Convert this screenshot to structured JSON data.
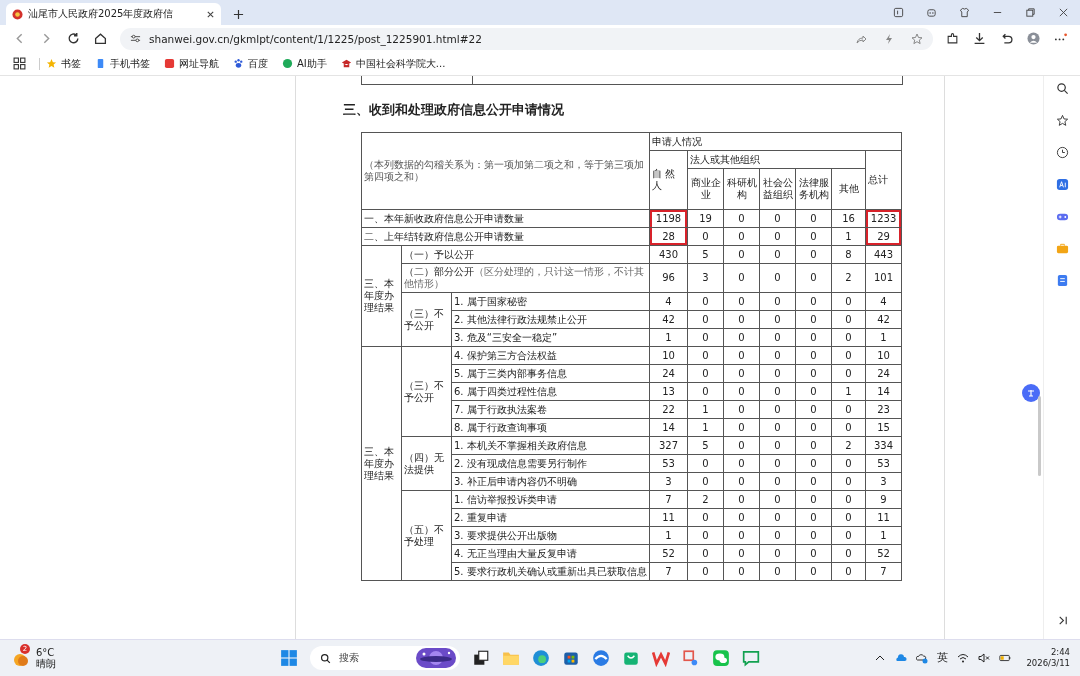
{
  "browser": {
    "tab_title": "汕尾市人民政府2025年度政府信",
    "url": "shanwei.gov.cn/gkmlpt/content/1/1225/post_1225901.html#22",
    "bookmarks": [
      {
        "label": "书签",
        "kind": "star"
      },
      {
        "label": "手机书签",
        "kind": "phone"
      },
      {
        "label": "网址导航",
        "kind": "nav"
      },
      {
        "label": "百度",
        "kind": "paw"
      },
      {
        "label": "AI助手",
        "kind": "ai"
      },
      {
        "label": "中国社会科学院大...",
        "kind": "school"
      }
    ]
  },
  "document": {
    "heading": "三、收到和处理政府信息公开申请情况",
    "table": {
      "note": "（本列数据的勾稽关系为：第一项加第二项之和，等于第三项加第四项之和）",
      "applicant_header": "申请人情况",
      "org_header": "法人或其他组织",
      "columns": [
        {
          "label": "自 然人",
          "boxed": true
        },
        {
          "label": "商业企业",
          "boxed": false
        },
        {
          "label": "科研机构",
          "boxed": false
        },
        {
          "label": "社会公益组织",
          "boxed": false
        },
        {
          "label": "法律服务机构",
          "boxed": false
        },
        {
          "label": "其他",
          "boxed": false
        },
        {
          "label": "总计",
          "boxed": true
        }
      ],
      "summary_rows": [
        {
          "label": "一、本年新收政府信息公开申请数量",
          "values": [
            "1198",
            "19",
            "0",
            "0",
            "0",
            "16",
            "1233"
          ]
        },
        {
          "label": "二、上年结转政府信息公开申请数量",
          "values": [
            "28",
            "0",
            "0",
            "0",
            "0",
            "1",
            "29"
          ]
        }
      ],
      "sections": [
        {
          "label": "三、本年度办理结果",
          "groups": [
            {
              "label": "（一）予以公开",
              "values": [
                "430",
                "5",
                "0",
                "0",
                "0",
                "8",
                "443"
              ]
            },
            {
              "label": "（二）部分公开",
              "note": "（区分处理的，只计这一情形，不计其他情形）",
              "values": [
                "96",
                "3",
                "0",
                "0",
                "0",
                "2",
                "101"
              ]
            },
            {
              "label": "（三）不予公开",
              "items": [
                {
                  "label": "1. 属于国家秘密",
                  "values": [
                    "4",
                    "0",
                    "0",
                    "0",
                    "0",
                    "0",
                    "4"
                  ]
                },
                {
                  "label": "2. 其他法律行政法规禁止公开",
                  "values": [
                    "42",
                    "0",
                    "0",
                    "0",
                    "0",
                    "0",
                    "42"
                  ]
                },
                {
                  "label": "3. 危及“三安全一稳定”",
                  "values": [
                    "1",
                    "0",
                    "0",
                    "0",
                    "0",
                    "0",
                    "1"
                  ]
                }
              ]
            }
          ]
        },
        {
          "label": "三、本年度办理结果",
          "groups": [
            {
              "label": "（三）不予公开",
              "items": [
                {
                  "label": "4. 保护第三方合法权益",
                  "values": [
                    "10",
                    "0",
                    "0",
                    "0",
                    "0",
                    "0",
                    "10"
                  ]
                },
                {
                  "label": "5. 属于三类内部事务信息",
                  "values": [
                    "24",
                    "0",
                    "0",
                    "0",
                    "0",
                    "0",
                    "24"
                  ]
                },
                {
                  "label": "6. 属于四类过程性信息",
                  "values": [
                    "13",
                    "0",
                    "0",
                    "0",
                    "0",
                    "1",
                    "14"
                  ]
                },
                {
                  "label": "7. 属于行政执法案卷",
                  "values": [
                    "22",
                    "1",
                    "0",
                    "0",
                    "0",
                    "0",
                    "23"
                  ]
                },
                {
                  "label": "8. 属于行政查询事项",
                  "values": [
                    "14",
                    "1",
                    "0",
                    "0",
                    "0",
                    "0",
                    "15"
                  ]
                }
              ]
            },
            {
              "label": "（四）无法提供",
              "items": [
                {
                  "label": "1. 本机关不掌握相关政府信息",
                  "values": [
                    "327",
                    "5",
                    "0",
                    "0",
                    "0",
                    "2",
                    "334"
                  ]
                },
                {
                  "label": "2. 没有现成信息需要另行制作",
                  "values": [
                    "53",
                    "0",
                    "0",
                    "0",
                    "0",
                    "0",
                    "53"
                  ]
                },
                {
                  "label": "3. 补正后申请内容仍不明确",
                  "values": [
                    "3",
                    "0",
                    "0",
                    "0",
                    "0",
                    "0",
                    "3"
                  ]
                }
              ]
            },
            {
              "label": "（五）不予处理",
              "items": [
                {
                  "label": "1. 信访举报投诉类申请",
                  "values": [
                    "7",
                    "2",
                    "0",
                    "0",
                    "0",
                    "0",
                    "9"
                  ]
                },
                {
                  "label": "2. 重复申请",
                  "values": [
                    "11",
                    "0",
                    "0",
                    "0",
                    "0",
                    "0",
                    "11"
                  ]
                },
                {
                  "label": "3. 要求提供公开出版物",
                  "values": [
                    "1",
                    "0",
                    "0",
                    "0",
                    "0",
                    "0",
                    "1"
                  ]
                },
                {
                  "label": "4. 无正当理由大量反复申请",
                  "values": [
                    "52",
                    "0",
                    "0",
                    "0",
                    "0",
                    "0",
                    "52"
                  ]
                },
                {
                  "label": "5. 要求行政机关确认或重新出具已获取信息",
                  "values": [
                    "7",
                    "0",
                    "0",
                    "0",
                    "0",
                    "0",
                    "7"
                  ]
                }
              ]
            }
          ]
        }
      ]
    }
  },
  "taskbar": {
    "weather_badge": "2",
    "temperature": "6°C",
    "condition": "晴朗",
    "search_placeholder": "搜索",
    "ime": "英",
    "time": "2:44",
    "date": "2026/3/11"
  }
}
